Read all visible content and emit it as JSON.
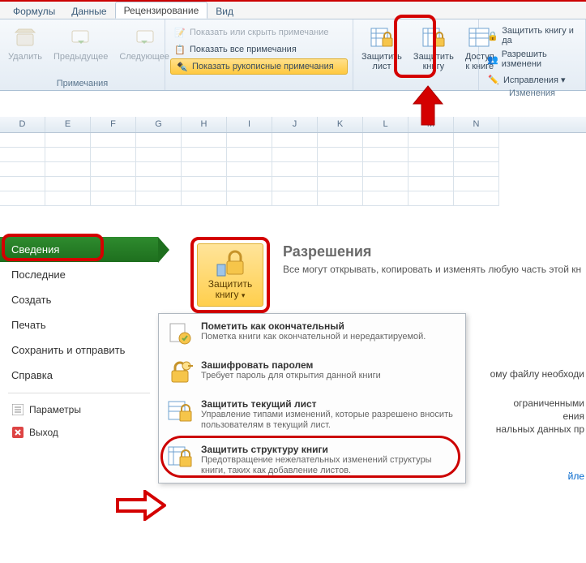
{
  "ribbon": {
    "tabs": {
      "formulas": "Формулы",
      "data": "Данные",
      "review": "Рецензирование",
      "view": "Вид"
    },
    "buttons": {
      "delete": "Удалить",
      "previous": "Предыдущее",
      "next": "Следующее"
    },
    "notes": {
      "show_hide": "Показать или скрыть примечание",
      "show_all": "Показать все примечания",
      "show_ink": "Показать рукописные примечания",
      "group": "Примечания"
    },
    "protect": {
      "sheet": "Защитить\nлист",
      "book": "Защитить\nкнигу",
      "share": "Доступ\nк книге",
      "protect_share": "Защитить книгу и да",
      "allow_edit": "Разрешить изменени",
      "corrections": "Исправления ▾",
      "group": "Изменения"
    }
  },
  "columns": [
    "D",
    "E",
    "F",
    "G",
    "H",
    "I",
    "J",
    "K",
    "L",
    "M",
    "N"
  ],
  "backstage": {
    "tabs": {
      "info": "Сведения",
      "recent": "Последние",
      "new": "Создать",
      "print": "Печать",
      "save_send": "Сохранить и отправить",
      "help": "Справка",
      "options": "Параметры",
      "exit": "Выход"
    },
    "permissions": {
      "title": "Разрешения",
      "desc": "Все могут открывать, копировать и изменять любую часть этой кн"
    },
    "protect_btn": {
      "label": "Защитить\nкнигу ▾"
    },
    "menu": {
      "final_t": "Пометить как окончательный",
      "final_d": "Пометка книги как окончательной и нередактируемой.",
      "encrypt_t": "Зашифровать паролем",
      "encrypt_d": "Требует пароль для открытия данной книги",
      "sheet_t": "Защитить текущий лист",
      "sheet_d": "Управление типами изменений, которые разрешено вносить пользователям в текущий лист.",
      "struct_t": "Защитить структуру книги",
      "struct_d": "Предотвращение нежелательных изменений структуры книги, таких как добавление листов."
    },
    "side": {
      "file": "ому файлу необходи",
      "limited1": "ограниченными",
      "limited2": "ения",
      "limited3": "нальных данных пр",
      "link": "йле"
    }
  }
}
